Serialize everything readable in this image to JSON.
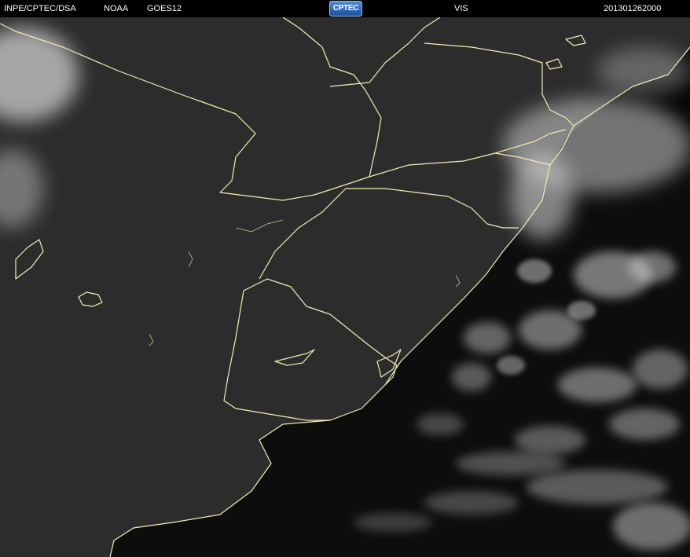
{
  "header": {
    "source": "INPE/CPTEC/DSA",
    "agency": "NOAA",
    "satellite": "GOES12",
    "logo_text": "CPTEC",
    "channel": "VIS",
    "timestamp": "201301262000"
  },
  "colors": {
    "background": "#000000",
    "header_text": "#ffffff",
    "land": "#2b2b2b",
    "ocean": "#050505",
    "cloud": "#c8c8c8",
    "border_line": "#f3eeb4"
  }
}
